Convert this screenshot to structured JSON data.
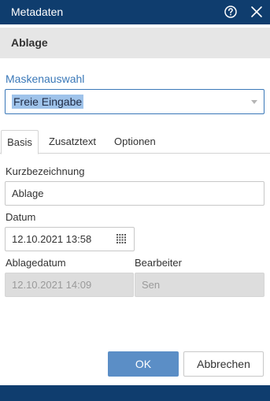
{
  "window": {
    "title": "Metadaten",
    "help_icon": "help-circle-icon",
    "close_icon": "close-icon"
  },
  "section": {
    "title": "Ablage"
  },
  "mask": {
    "label": "Maskenauswahl",
    "selected": "Freie Eingabe"
  },
  "tabs": [
    {
      "label": "Basis",
      "active": true
    },
    {
      "label": "Zusatztext",
      "active": false
    },
    {
      "label": "Optionen",
      "active": false
    }
  ],
  "fields": {
    "kurzbezeichnung": {
      "label": "Kurzbezeichnung",
      "value": "Ablage"
    },
    "datum": {
      "label": "Datum",
      "value": "12.10.2021 13:58",
      "icon": "calendar-icon"
    },
    "ablagedatum": {
      "label": "Ablagedatum",
      "value": "12.10.2021 14:09",
      "disabled": true
    },
    "bearbeiter": {
      "label": "Bearbeiter",
      "value": "Sen",
      "disabled": true
    }
  },
  "buttons": {
    "ok": "OK",
    "cancel": "Abbrechen"
  },
  "colors": {
    "titlebar": "#0f3d6e",
    "accent": "#3a78b8",
    "primary_button": "#5b8ec6",
    "selection": "#9fc3ea",
    "disabled_field": "#dddddd"
  }
}
